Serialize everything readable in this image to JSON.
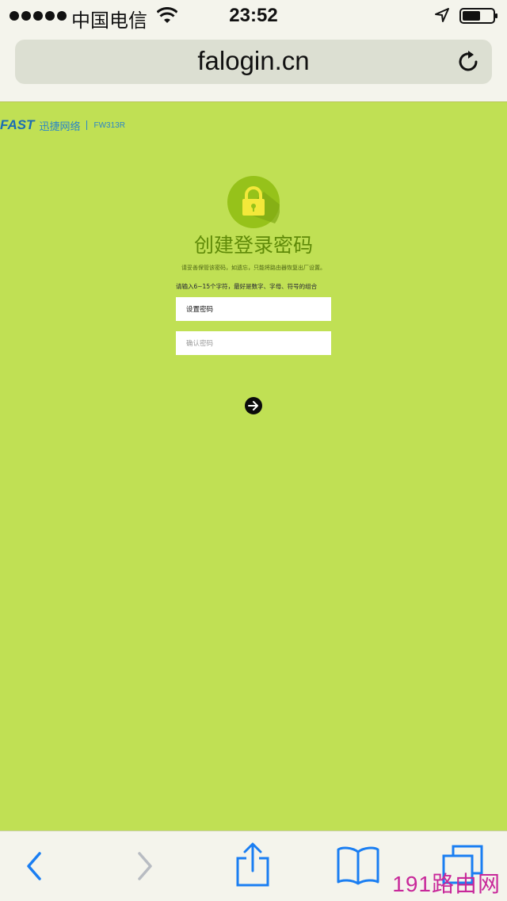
{
  "status_bar": {
    "carrier": "中国电信",
    "time": "23:52"
  },
  "browser": {
    "url": "falogin.cn"
  },
  "brand": {
    "logo": "FAST",
    "name": "迅捷网络",
    "model": "FW313R"
  },
  "form": {
    "title": "创建登录密码",
    "subtitle": "请妥善保管该密码，如遗忘，只能将路由器恢复出厂设置。",
    "hint": "请输入6~15个字符，最好是数字、字母、符号的组合",
    "set_password_placeholder": "设置密码",
    "confirm_password_placeholder": "确认密码"
  },
  "watermark": "191路由网",
  "colors": {
    "page_background": "#c0e054",
    "title": "#5f8a08",
    "brand": "#1b6db4",
    "ios_accent": "#1a7ef2",
    "lock_yellow": "#f3e83a"
  },
  "icons": {
    "wifi": "wifi-icon",
    "location": "location-arrow-icon",
    "battery": "battery-icon",
    "reload": "reload-icon",
    "lock": "lock-icon",
    "submit": "arrow-right-icon",
    "back": "chevron-left-icon",
    "forward": "chevron-right-icon",
    "share": "share-icon",
    "bookmarks": "book-icon",
    "tabs": "tabs-icon"
  }
}
